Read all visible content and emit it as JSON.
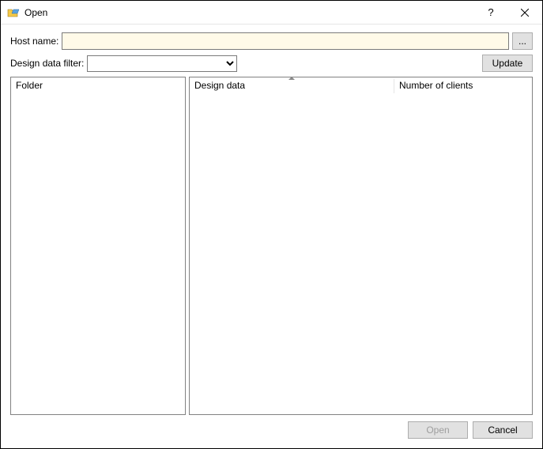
{
  "titlebar": {
    "title": "Open",
    "help": "?",
    "close": "✕"
  },
  "hostname": {
    "label": "Host name:",
    "value": "",
    "browse": "..."
  },
  "filter": {
    "label": "Design data filter:",
    "value": "",
    "update": "Update"
  },
  "columns": {
    "folder": "Folder",
    "design_data": "Design data",
    "clients": "Number of clients"
  },
  "footer": {
    "open": "Open",
    "cancel": "Cancel"
  }
}
